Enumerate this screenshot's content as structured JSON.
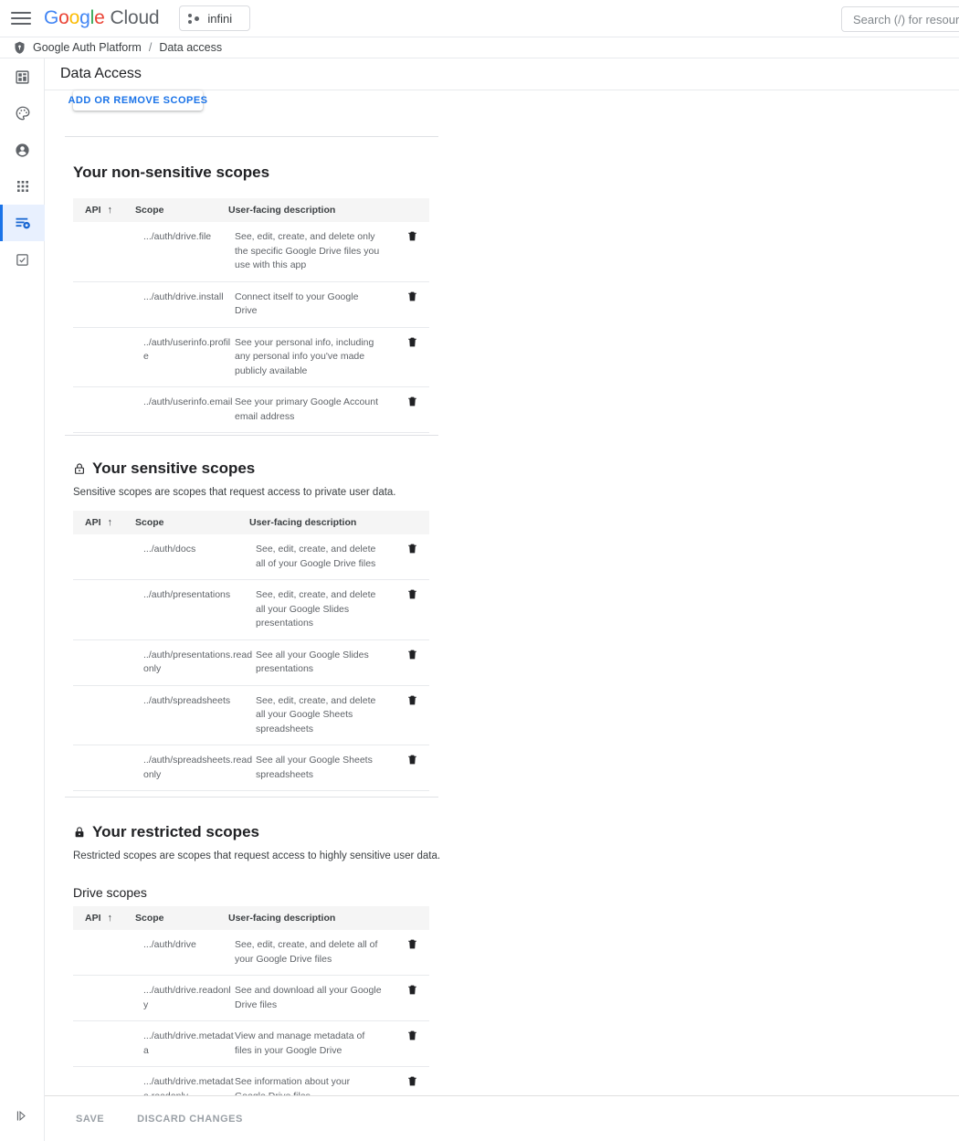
{
  "appbar": {
    "menu_icon": "hamburger-menu-icon",
    "brand_google": "Google",
    "brand_cloud": "Cloud",
    "project_chip_label": "infini",
    "project_chip_icon": "project-dots-icon",
    "search_placeholder": "Search (/) for resources, docs, products, and more",
    "search_value": ""
  },
  "breadcrumb": {
    "shield_icon": "shield-icon",
    "root": "Google Auth Platform",
    "separator": "/",
    "current": "Data access"
  },
  "rail": {
    "items": [
      {
        "name": "sidebar-item-overview",
        "icon": "dashboard-icon",
        "active": false
      },
      {
        "name": "sidebar-item-branding",
        "icon": "palette-icon",
        "active": false
      },
      {
        "name": "sidebar-item-audience",
        "icon": "account-circle-icon",
        "active": false
      },
      {
        "name": "sidebar-item-clients",
        "icon": "apps-grid-icon",
        "active": false
      },
      {
        "name": "sidebar-item-data-access",
        "icon": "data-access-icon",
        "active": true
      },
      {
        "name": "sidebar-item-verification",
        "icon": "checkbox-task-icon",
        "active": false
      }
    ],
    "expand_icon": "expand-panel-icon"
  },
  "page": {
    "title": "Data Access",
    "add_remove_scopes_label": "ADD OR REMOVE SCOPES"
  },
  "table_headers": {
    "api": "API",
    "sort_arrow": "↑",
    "scope": "Scope",
    "description": "User-facing description"
  },
  "sections": {
    "non_sensitive": {
      "icon": null,
      "title": "Your non-sensitive scopes",
      "description": null,
      "rows": [
        {
          "api": "",
          "scope": ".../auth/drive.file",
          "desc": "See, edit, create, and delete only the specific Google Drive files you use with this app",
          "delete_icon": "trash-icon"
        },
        {
          "api": "",
          "scope": ".../auth/drive.install",
          "desc": "Connect itself to your Google Drive",
          "delete_icon": "trash-icon"
        },
        {
          "api": "",
          "scope": "../auth/userinfo.profile",
          "desc": "See your personal info, including any personal info you've made publicly available",
          "delete_icon": "trash-icon"
        },
        {
          "api": "",
          "scope": "../auth/userinfo.email",
          "desc": "See your primary Google Account email address",
          "delete_icon": "trash-icon"
        }
      ]
    },
    "sensitive": {
      "icon": "lock-outline-icon",
      "title": "Your sensitive scopes",
      "description": "Sensitive scopes are scopes that request access to private user data.",
      "rows": [
        {
          "api": "",
          "scope": ".../auth/docs",
          "desc": "See, edit, create, and delete all of your Google Drive files",
          "delete_icon": "trash-icon"
        },
        {
          "api": "",
          "scope": "../auth/presentations",
          "desc": "See, edit, create, and delete all your Google Slides presentations",
          "delete_icon": "trash-icon"
        },
        {
          "api": "",
          "scope": "../auth/presentations.readonly",
          "desc": "See all your Google Slides presentations",
          "delete_icon": "trash-icon"
        },
        {
          "api": "",
          "scope": "../auth/spreadsheets",
          "desc": "See, edit, create, and delete all your Google Sheets spreadsheets",
          "delete_icon": "trash-icon"
        },
        {
          "api": "",
          "scope": "../auth/spreadsheets.readonly",
          "desc": "See all your Google Sheets spreadsheets",
          "delete_icon": "trash-icon"
        }
      ]
    },
    "restricted": {
      "icon": "lock-filled-icon",
      "title": "Your restricted scopes",
      "description": "Restricted scopes are scopes that request access to highly sensitive user data.",
      "subsection_title": "Drive scopes",
      "rows": [
        {
          "api": "",
          "scope": ".../auth/drive",
          "desc": "See, edit, create, and delete all of your Google Drive files",
          "delete_icon": "trash-icon"
        },
        {
          "api": "",
          "scope": ".../auth/drive.readonly",
          "desc": "See and download all your Google Drive files",
          "delete_icon": "trash-icon"
        },
        {
          "api": "",
          "scope": ".../auth/drive.metadata",
          "desc": "View and manage metadata of files in your Google Drive",
          "delete_icon": "trash-icon"
        },
        {
          "api": "",
          "scope": ".../auth/drive.metadata.readonly",
          "desc": "See information about your Google Drive files",
          "delete_icon": "trash-icon"
        }
      ]
    }
  },
  "action_bar": {
    "save_label": "SAVE",
    "discard_label": "DISCARD CHANGES"
  },
  "colors": {
    "accent_blue": "#1a73e8",
    "active_bg": "#e8f0fe",
    "header_bg": "#f5f5f5",
    "text_primary": "#202124",
    "text_secondary": "#5f6368",
    "disabled": "#9aa0a6"
  }
}
